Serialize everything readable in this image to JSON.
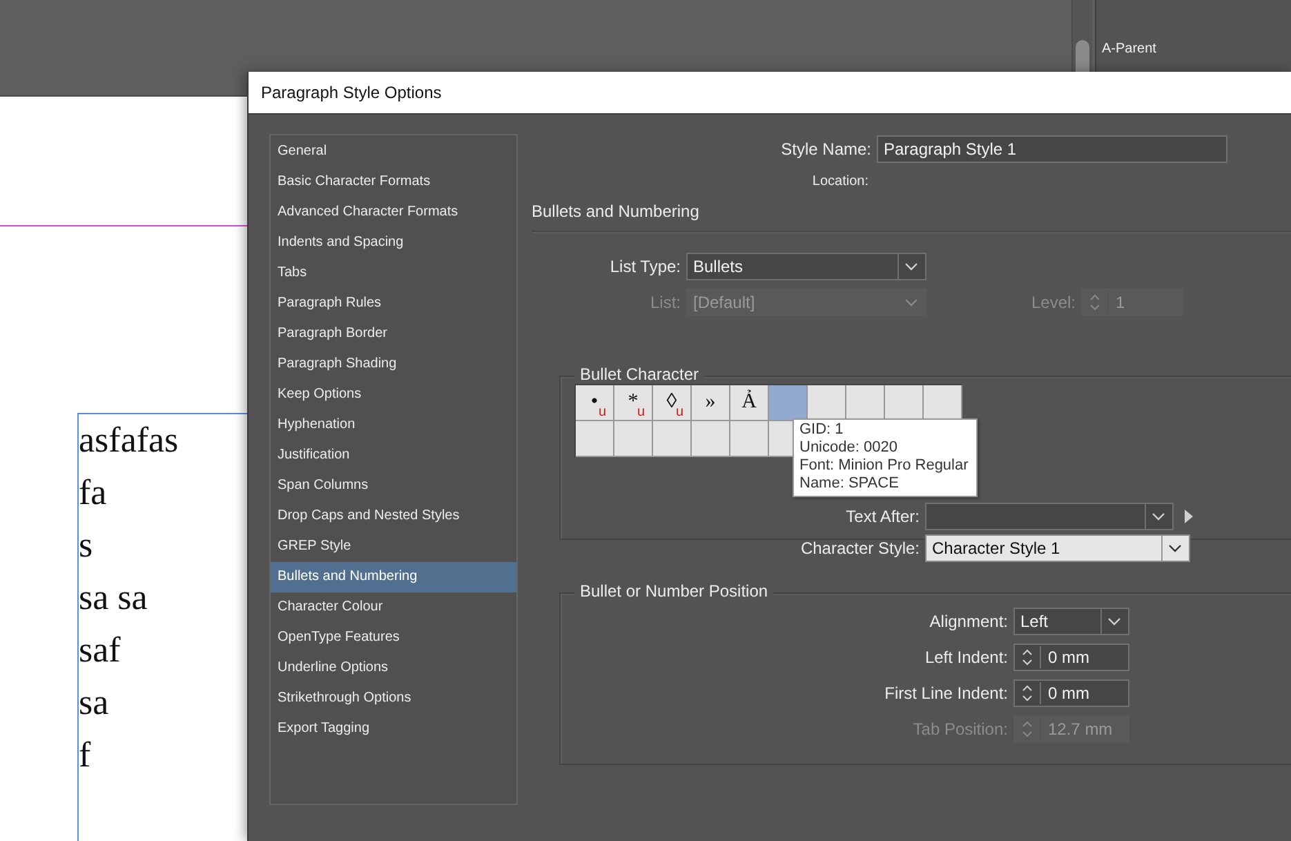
{
  "app": {
    "panel_item": "A-Parent"
  },
  "document": {
    "lines": [
      "asfafas",
      "fa",
      "s",
      "sa sa",
      "saf",
      "sa",
      "f"
    ]
  },
  "dialog": {
    "title": "Paragraph Style Options",
    "categories": [
      {
        "label": "General",
        "selected": false
      },
      {
        "label": "Basic Character Formats",
        "selected": false
      },
      {
        "label": "Advanced Character Formats",
        "selected": false
      },
      {
        "label": "Indents and Spacing",
        "selected": false
      },
      {
        "label": "Tabs",
        "selected": false
      },
      {
        "label": "Paragraph Rules",
        "selected": false
      },
      {
        "label": "Paragraph Border",
        "selected": false
      },
      {
        "label": "Paragraph Shading",
        "selected": false
      },
      {
        "label": "Keep Options",
        "selected": false
      },
      {
        "label": "Hyphenation",
        "selected": false
      },
      {
        "label": "Justification",
        "selected": false
      },
      {
        "label": "Span Columns",
        "selected": false
      },
      {
        "label": "Drop Caps and Nested Styles",
        "selected": false
      },
      {
        "label": "GREP Style",
        "selected": false
      },
      {
        "label": "Bullets and Numbering",
        "selected": true
      },
      {
        "label": "Character Colour",
        "selected": false
      },
      {
        "label": "OpenType Features",
        "selected": false
      },
      {
        "label": "Underline Options",
        "selected": false
      },
      {
        "label": "Strikethrough Options",
        "selected": false
      },
      {
        "label": "Export Tagging",
        "selected": false
      }
    ],
    "style_name": {
      "label": "Style Name:",
      "value": "Paragraph Style 1"
    },
    "location": {
      "label": "Location:"
    },
    "section_title": "Bullets and Numbering",
    "list_type": {
      "label": "List Type:",
      "value": "Bullets",
      "disabled": false
    },
    "list": {
      "label": "List:",
      "value": "[Default]",
      "disabled": true
    },
    "level": {
      "label": "Level:",
      "value": "1",
      "disabled": true
    },
    "bullet_character": {
      "title": "Bullet Character",
      "glyphs": [
        {
          "char": "•",
          "mark": "u",
          "selected": false
        },
        {
          "char": "*",
          "mark": "u",
          "selected": false
        },
        {
          "char": "◊",
          "mark": "u",
          "selected": false
        },
        {
          "char": "»",
          "selected": false
        },
        {
          "char": "Ả",
          "selected": false
        },
        {
          "selected": true
        }
      ],
      "tooltip": [
        "GID: 1",
        "Unicode: 0020",
        "Font: Minion Pro Regular",
        "Name: SPACE"
      ],
      "text_after": {
        "label": "Text After:"
      },
      "character_style": {
        "label": "Character Style:",
        "value": "Character Style 1"
      }
    },
    "position": {
      "title": "Bullet or Number Position",
      "fields": [
        {
          "kind": "select",
          "label": "Alignment:",
          "value": "Left",
          "disabled": false
        },
        {
          "kind": "spinner",
          "label": "Left Indent:",
          "value": "0 mm",
          "disabled": false
        },
        {
          "kind": "spinner",
          "label": "First Line Indent:",
          "value": "0 mm",
          "disabled": false
        },
        {
          "kind": "spinner",
          "label": "Tab Position:",
          "value": "12.7 mm",
          "disabled": true
        }
      ]
    }
  }
}
